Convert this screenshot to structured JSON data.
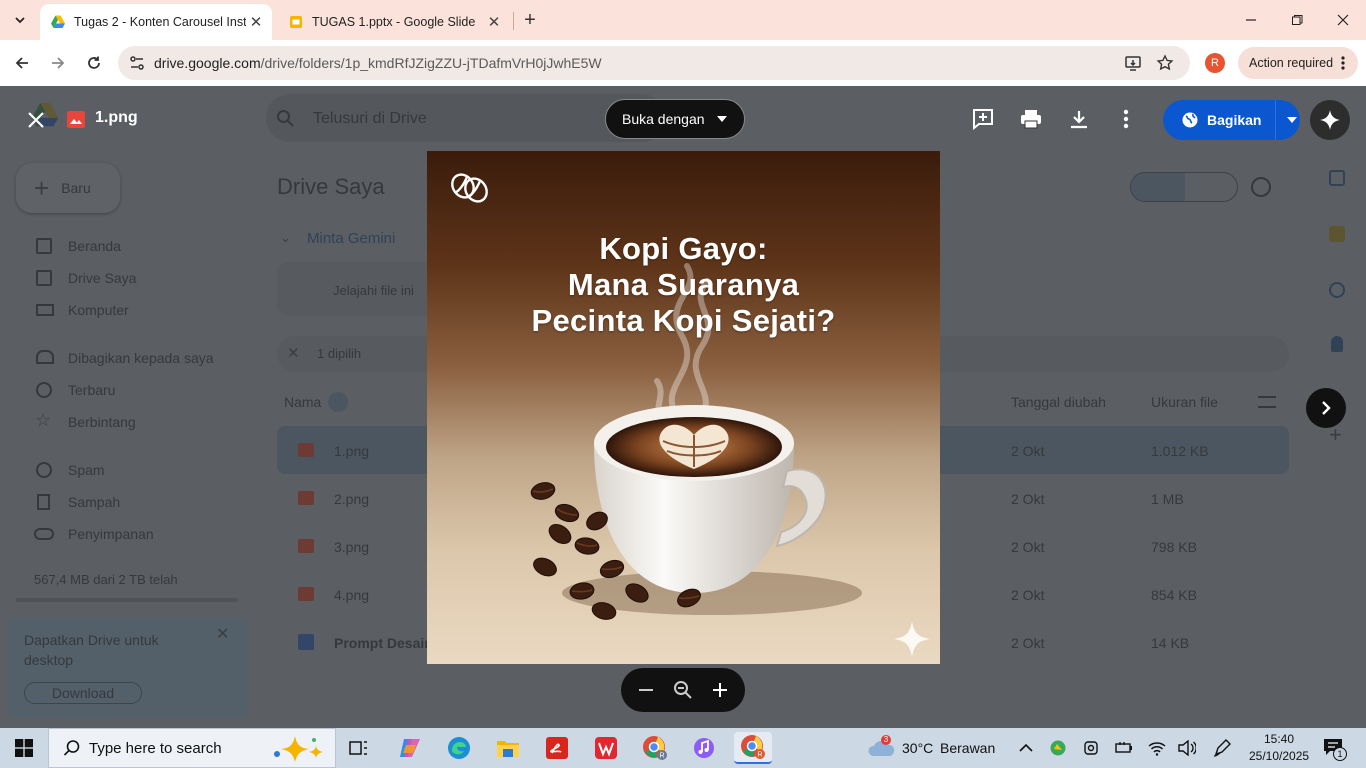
{
  "browser": {
    "tabs": [
      {
        "title": "Tugas 2 - Konten Carousel Insta",
        "active": true
      },
      {
        "title": "TUGAS 1.pptx - Google Slide",
        "active": false
      }
    ],
    "new_tab": "+",
    "url_host": "drive.google.com",
    "url_path": "/drive/folders/1p_kmdRfJZigZZU-jTDafmVrH0jJwhE5W",
    "profile_initial": "R",
    "action_required": "Action required"
  },
  "drive": {
    "search_placeholder": "Telusuri di Drive",
    "new_button": "Baru",
    "page_title": "Drive Saya",
    "gemini": "Minta Gemini",
    "explore": "Jelajahi file ini",
    "selected": "1 dipilih",
    "sidebar": [
      {
        "label": "Beranda"
      },
      {
        "label": "Drive Saya"
      },
      {
        "label": "Komputer"
      },
      {
        "label": "Dibagikan kepada saya"
      },
      {
        "label": "Terbaru"
      },
      {
        "label": "Berbintang"
      },
      {
        "label": "Spam"
      },
      {
        "label": "Sampah"
      },
      {
        "label": "Penyimpanan"
      }
    ],
    "storage_text": "567,4 MB dari 2 TB telah",
    "promo_text": "Dapatkan Drive untuk desktop",
    "promo_button": "Download",
    "columns": {
      "name": "Nama",
      "modified": "Tanggal diubah",
      "size": "Ukuran file"
    },
    "rows": [
      {
        "name": "1.png",
        "modified": "2 Okt",
        "size": "1.012 KB"
      },
      {
        "name": "2.png",
        "modified": "2 Okt",
        "size": "1 MB"
      },
      {
        "name": "3.png",
        "modified": "2 Okt",
        "size": "798 KB"
      },
      {
        "name": "4.png",
        "modified": "2 Okt",
        "size": "854 KB"
      },
      {
        "name": "Prompt Desain",
        "modified": "2 Okt",
        "size": "14 KB"
      }
    ]
  },
  "viewer": {
    "file_name": "1.png",
    "open_with": "Buka dengan",
    "share": "Bagikan",
    "image": {
      "headline_line1": "Kopi Gayo:",
      "headline_line2": "Mana Suaranya",
      "headline_line3": "Pecinta Kopi Sejati?"
    }
  },
  "taskbar": {
    "search_placeholder": "Type here to search",
    "weather_temp": "30°C",
    "weather_text": "Berawan",
    "weather_badge": "3",
    "time": "15:40",
    "date": "25/10/2025",
    "notification_count": "1"
  }
}
